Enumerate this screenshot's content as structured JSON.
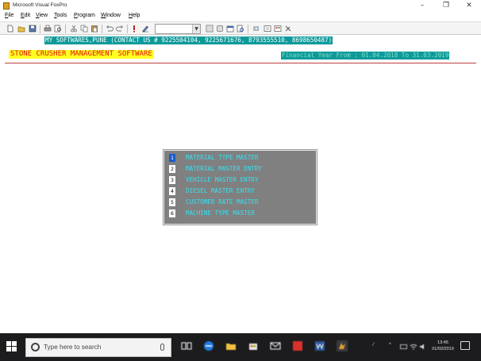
{
  "window": {
    "title": "Microsoft Visual FoxPro",
    "controls": [
      "minimize-icon",
      "maximize-icon",
      "close-icon"
    ]
  },
  "menubar": {
    "items": [
      {
        "label": "File",
        "accel": "F",
        "rest": "ile"
      },
      {
        "label": "Edit",
        "accel": "E",
        "rest": "dit"
      },
      {
        "label": "View",
        "accel": "V",
        "rest": "iew"
      },
      {
        "label": "Tools",
        "accel": "T",
        "rest": "ools"
      },
      {
        "label": "Program",
        "accel": "P",
        "rest": "rogram"
      },
      {
        "label": "Window",
        "accel": "W",
        "rest": "indow"
      },
      {
        "label": "Help",
        "accel": "H",
        "rest": "elp"
      }
    ]
  },
  "toolbar": {
    "combo_value": ""
  },
  "screen": {
    "contact": "MY SOFTWARES,PUNE (CONTACT US # 9225504104, 9225671676, 8793555510, 8698650487)",
    "app_title": "STONE CRUSHER MANAGEMENT SOFTWARE",
    "financial_year": "Financial Year From : 01.04.2018 To 31.03.2019",
    "colors": {
      "contact_bg": "#0e9a9a",
      "title_bg": "#ffff22",
      "title_fg": "#e01010",
      "popup_bg": "#808080",
      "popup_fg": "#36e0f0",
      "selected": "#1a5cc8"
    }
  },
  "popup_menu": {
    "items": [
      {
        "num": "1",
        "label": "MATERIAL TYPE MASTER",
        "selected": true
      },
      {
        "num": "2",
        "label": "MATERIAL MASTER ENTRY",
        "selected": false
      },
      {
        "num": "3",
        "label": "VEHICLE MASTER ENTRY",
        "selected": false
      },
      {
        "num": "4",
        "label": "DIESEL MASTER ENTRY",
        "selected": false
      },
      {
        "num": "5",
        "label": "CUSTOMER RATE MASTER",
        "selected": false
      },
      {
        "num": "6",
        "label": "MACHINE TYPE MASTER",
        "selected": false
      }
    ]
  },
  "taskbar": {
    "search_placeholder": "Type here to search",
    "clock_time": "13:45",
    "clock_date": "01/02/2019"
  }
}
